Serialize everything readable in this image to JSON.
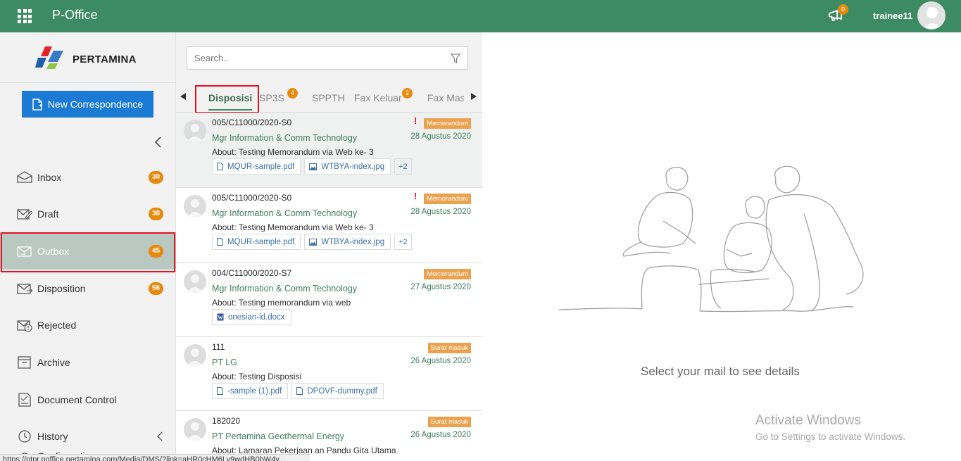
{
  "topbar": {
    "app_title": "P-Office",
    "notification_count": "0",
    "username": "trainee11"
  },
  "sidebar": {
    "logo_text": "PERTAMINA",
    "new_button": "New Correspondence",
    "items": [
      {
        "label": "Inbox",
        "badge": "30",
        "icon": "inbox-icon"
      },
      {
        "label": "Draft",
        "badge": "38",
        "icon": "draft-icon"
      },
      {
        "label": "Outbox",
        "badge": "45",
        "icon": "outbox-icon",
        "active": true
      },
      {
        "label": "Disposition",
        "badge": "56",
        "icon": "disposition-icon"
      },
      {
        "label": "Rejected",
        "badge": "",
        "icon": "rejected-icon"
      },
      {
        "label": "Archive",
        "badge": "",
        "icon": "archive-icon"
      },
      {
        "label": "Document Control",
        "badge": "",
        "icon": "document-control-icon"
      },
      {
        "label": "History",
        "badge": "",
        "icon": "history-icon"
      },
      {
        "label": "Configuration",
        "badge": "",
        "icon": "gear-icon"
      }
    ]
  },
  "search": {
    "placeholder": "Search.."
  },
  "tabs": [
    {
      "label": "Disposisi",
      "badge": ""
    },
    {
      "label": "SP3S",
      "badge": "4"
    },
    {
      "label": "SPPTH",
      "badge": ""
    },
    {
      "label": "Fax Keluar",
      "badge": "2"
    },
    {
      "label": "Fax Masuk",
      "badge": ""
    }
  ],
  "mails": [
    {
      "number": "005/C11000/2020-S0",
      "from": "Mgr Information & Comm Technology",
      "about": "About: Testing Memorandum via Web ke- 3",
      "type": "Memorandum",
      "priority": "!",
      "date": "28 Agustus 2020",
      "attachments": [
        {
          "name": "MQUR-sample.pdf",
          "kind": "pdf"
        },
        {
          "name": "WTBYA-index.jpg",
          "kind": "image"
        }
      ],
      "more": "+2"
    },
    {
      "number": "005/C11000/2020-S0",
      "from": "Mgr Information & Comm Technology",
      "about": "About: Testing Memorandum via Web ke- 3",
      "type": "Memorandum",
      "priority": "!",
      "date": "28 Agustus 2020",
      "attachments": [
        {
          "name": "MQUR-sample.pdf",
          "kind": "pdf"
        },
        {
          "name": "WTBYA-index.jpg",
          "kind": "image"
        }
      ],
      "more": "+2"
    },
    {
      "number": "004/C11000/2020-S7",
      "from": "Mgr Information & Comm Technology",
      "about": "About: Testing memorandum via web",
      "type": "Memorandum",
      "priority": "",
      "date": "27 Agustus 2020",
      "attachments": [
        {
          "name": "onesian-id.docx",
          "kind": "doc"
        }
      ],
      "more": ""
    },
    {
      "number": "111",
      "from": "PT LG",
      "about": "About: Testing Disposisi",
      "type": "Surat masuk",
      "priority": "",
      "date": "26 Agustus 2020",
      "attachments": [
        {
          "name": "-sample (1).pdf",
          "kind": "pdf"
        },
        {
          "name": "DPOVF-dummy.pdf",
          "kind": "pdf"
        }
      ],
      "more": ""
    },
    {
      "number": "182020",
      "from": "PT Pertamina Geothermal Energy",
      "about": "About: Lamaran Pekerjaan an Pandu Gita Utama",
      "type": "Surat masuk",
      "priority": "",
      "date": "26 Agustus 2020",
      "attachments": [],
      "more": ""
    }
  ],
  "detail": {
    "empty_message": "Select your mail to see details",
    "watermark_title": "Activate Windows",
    "watermark_sub": "Go to Settings to activate Windows."
  },
  "statusbar": {
    "url": "https://ptpr.poffice.pertamina.com/Media/DMS/?link=aHR0cHM6Ly9wdHB0bW4v..."
  },
  "colors": {
    "topbar": "#3d8b63",
    "primary_button": "#1a7ad4",
    "badge": "#e58a0c",
    "label_tag": "#eba24f",
    "highlight": "#e81123"
  }
}
